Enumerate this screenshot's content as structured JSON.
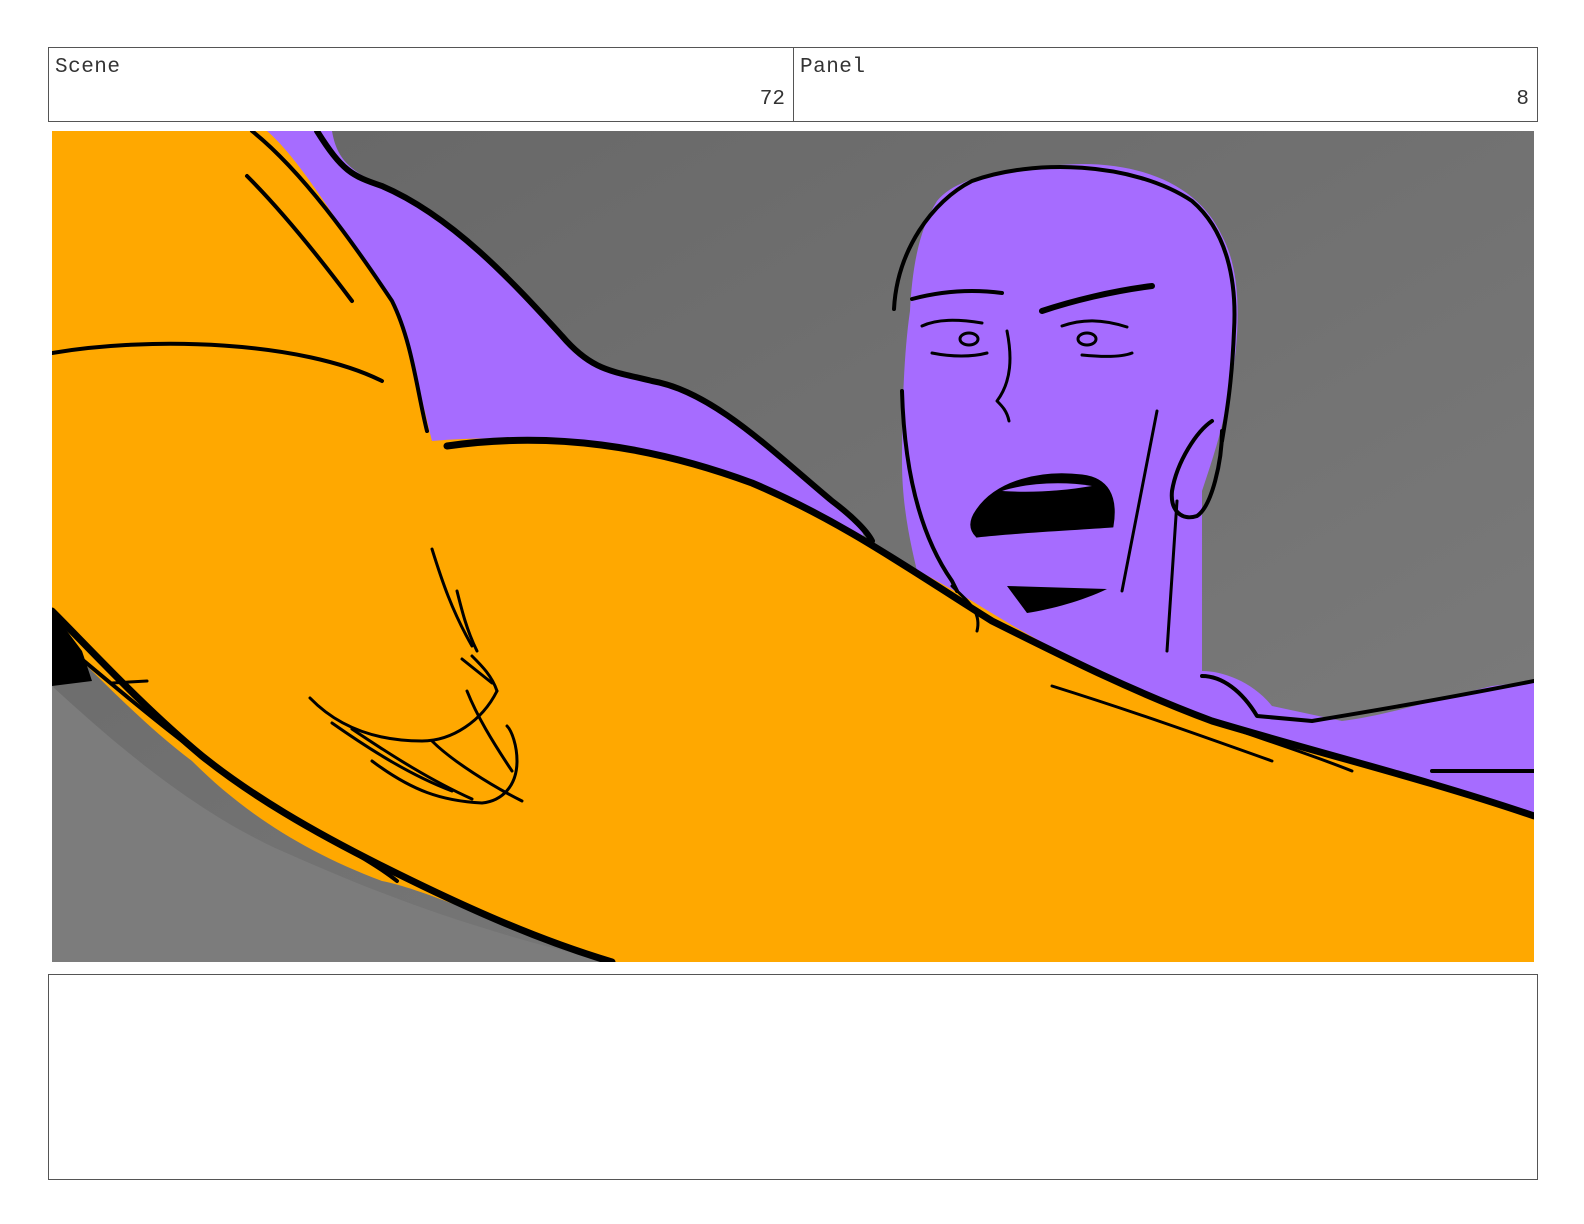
{
  "header": {
    "scene_label": "Scene",
    "scene_number": "72",
    "panel_label": "Panel",
    "panel_number": "8"
  },
  "artwork": {
    "background_color": "#6c6c6c",
    "figure_color": "#a66cff",
    "foreground_color": "#ffa800",
    "line_color": "#000000"
  },
  "notes": {
    "text": ""
  }
}
